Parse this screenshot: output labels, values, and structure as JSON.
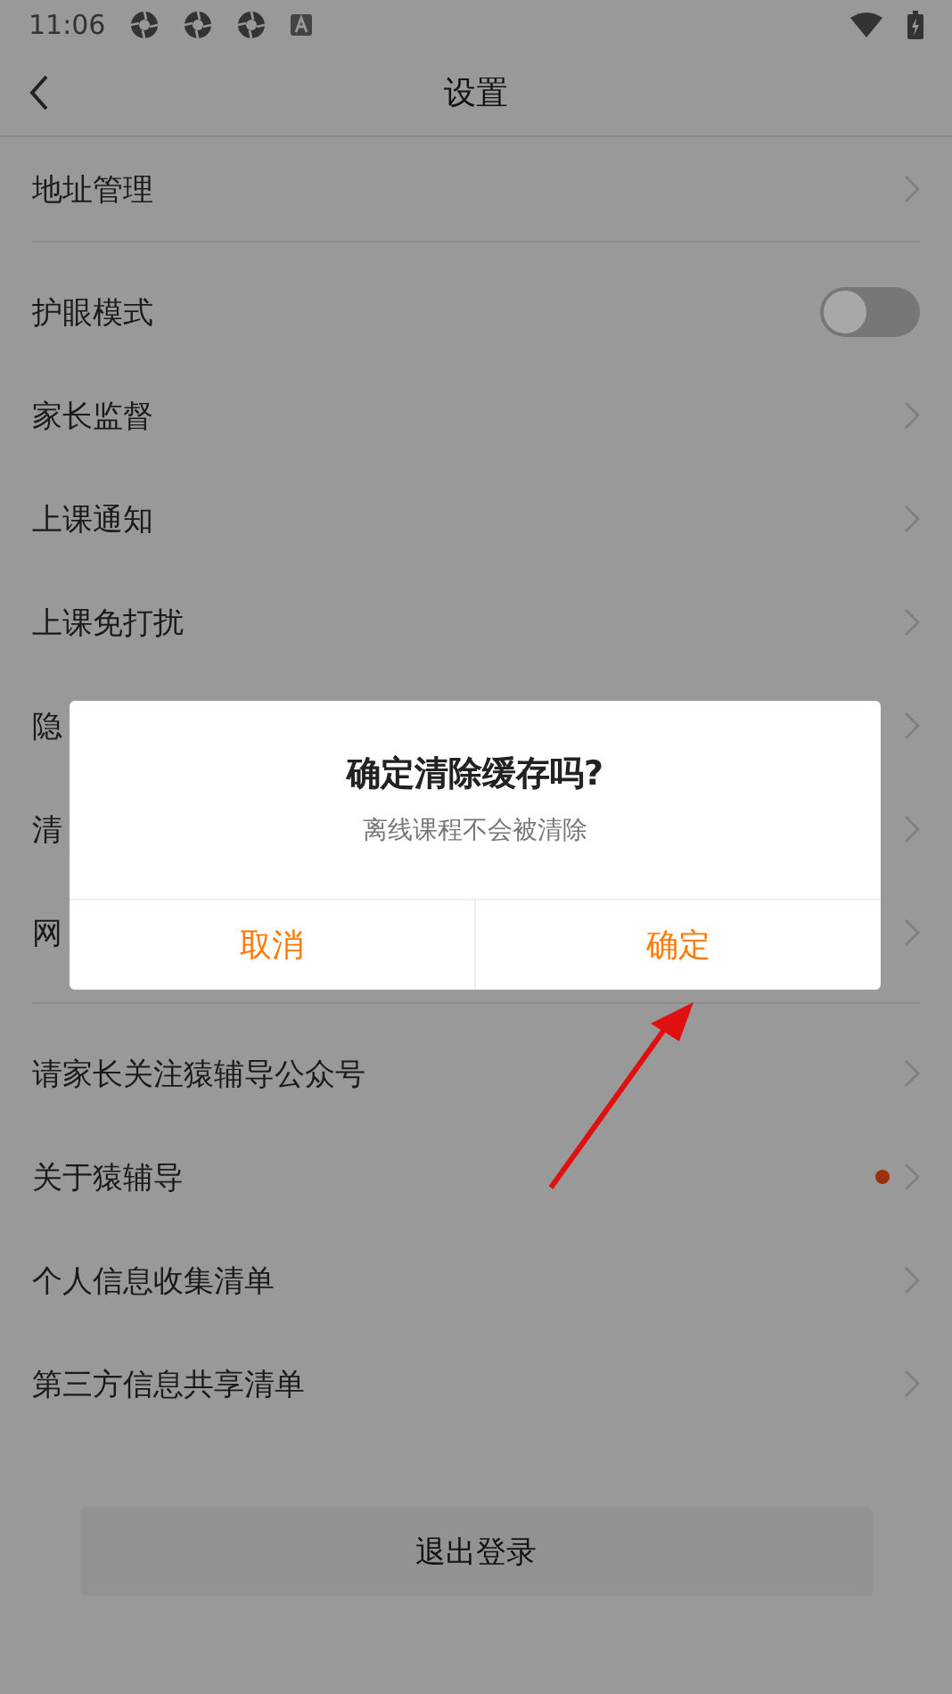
{
  "status_bar": {
    "time": "11:06"
  },
  "header": {
    "title": "设置"
  },
  "sections": [
    {
      "rows": [
        {
          "kind": "link",
          "label": "地址管理",
          "badge": false
        }
      ]
    },
    {
      "rows": [
        {
          "kind": "toggle",
          "label": "护眼模式",
          "on": false
        },
        {
          "kind": "link",
          "label": "家长监督",
          "badge": false
        },
        {
          "kind": "link",
          "label": "上课通知",
          "badge": false
        },
        {
          "kind": "link",
          "label": "上课免打扰",
          "badge": false
        },
        {
          "kind": "link",
          "label": "隐",
          "badge": false
        },
        {
          "kind": "link",
          "label": "清",
          "badge": false
        },
        {
          "kind": "link",
          "label": "网",
          "badge": false
        }
      ]
    },
    {
      "rows": [
        {
          "kind": "link",
          "label": "请家长关注猿辅导公众号",
          "badge": false
        },
        {
          "kind": "link",
          "label": "关于猿辅导",
          "badge": true
        },
        {
          "kind": "link",
          "label": "个人信息收集清单",
          "badge": false
        },
        {
          "kind": "link",
          "label": "第三方信息共享清单",
          "badge": false
        }
      ]
    }
  ],
  "logout_button": "退出登录",
  "dialog": {
    "title": "确定清除缓存吗?",
    "message": "离线课程不会被清除",
    "buttons": [
      "取消",
      "确定"
    ]
  }
}
